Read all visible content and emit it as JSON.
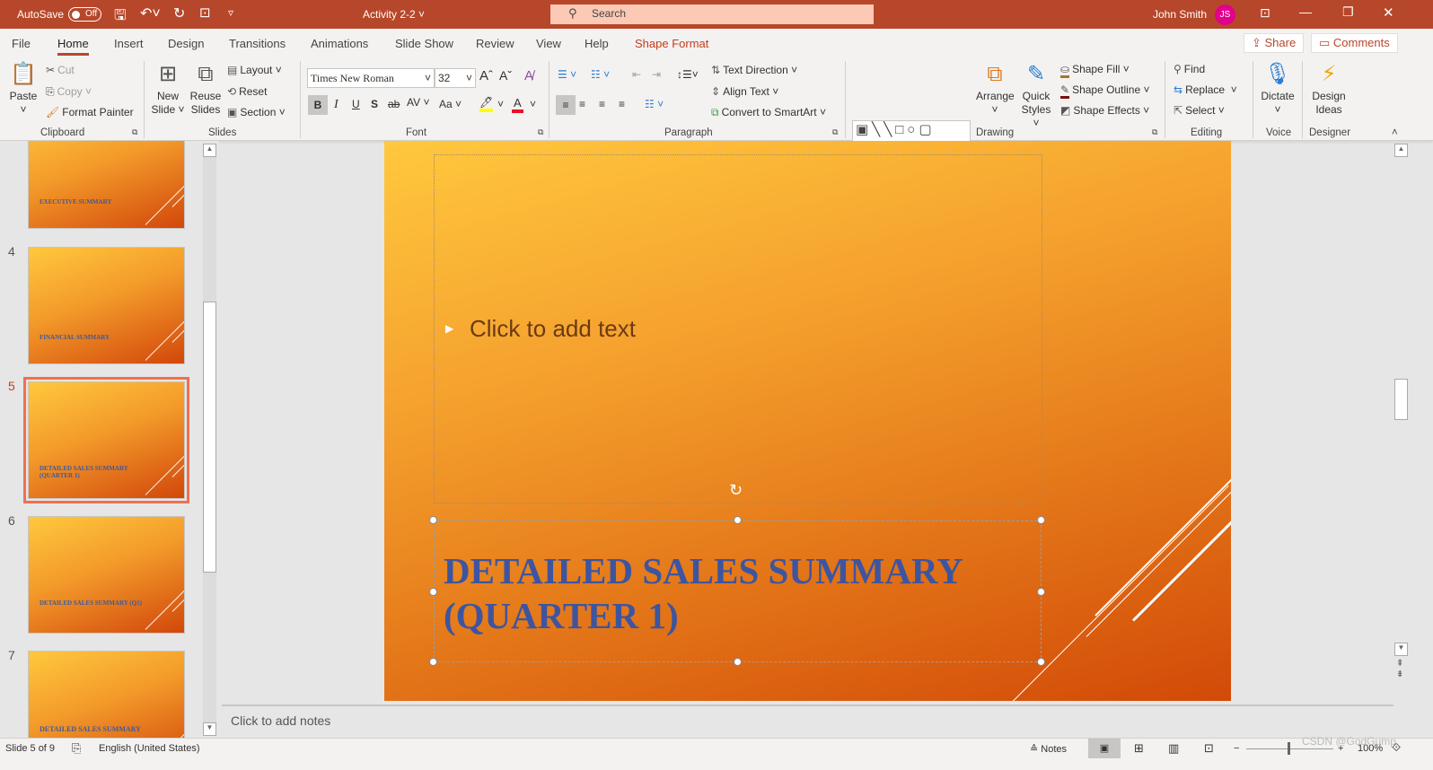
{
  "titlebar": {
    "autosave": "AutoSave",
    "autosave_state": "Off",
    "doc_title": "Activity 2-2",
    "search_placeholder": "Search",
    "user": "John Smith",
    "initials": "JS"
  },
  "tabs": [
    "File",
    "Home",
    "Insert",
    "Design",
    "Transitions",
    "Animations",
    "Slide Show",
    "Review",
    "View",
    "Help",
    "Shape Format"
  ],
  "share": "Share",
  "comments": "Comments",
  "ribbon": {
    "clipboard": {
      "paste": "Paste",
      "cut": "Cut",
      "copy": "Copy",
      "format_painter": "Format Painter",
      "label": "Clipboard"
    },
    "slides": {
      "new_slide": "New Slide",
      "reuse": "Reuse Slides",
      "layout": "Layout",
      "reset": "Reset",
      "section": "Section",
      "label": "Slides"
    },
    "font": {
      "family": "Times New Roman",
      "size": "32",
      "label": "Font"
    },
    "paragraph": {
      "text_direction": "Text Direction",
      "align_text": "Align Text",
      "smartart": "Convert to SmartArt",
      "label": "Paragraph"
    },
    "drawing": {
      "arrange": "Arrange",
      "quick_styles": "Quick Styles",
      "shape_fill": "Shape Fill",
      "shape_outline": "Shape Outline",
      "shape_effects": "Shape Effects",
      "label": "Drawing"
    },
    "editing": {
      "find": "Find",
      "replace": "Replace",
      "select": "Select",
      "label": "Editing"
    },
    "voice": {
      "dictate": "Dictate",
      "label": "Voice"
    },
    "designer": {
      "ideas": "Design Ideas",
      "label": "Designer"
    }
  },
  "thumbnails": [
    {
      "num": "",
      "title": "EXECUTIVE SUMMARY"
    },
    {
      "num": "4",
      "title": "FINANCIAL SUMMARY"
    },
    {
      "num": "5",
      "title": "DETAILED SALES SUMMARY (QUARTER 1)",
      "selected": true
    },
    {
      "num": "6",
      "title": "DETAILED SALES SUMMARY (Q1)"
    },
    {
      "num": "7",
      "title": "DETAILED SALES SUMMARY"
    }
  ],
  "slide": {
    "content_placeholder": "Click to add text",
    "title": "DETAILED SALES SUMMARY (QUARTER 1)"
  },
  "notes_placeholder": "Click to add notes",
  "status": {
    "slide": "Slide 5 of 9",
    "language": "English (United States)",
    "notes": "Notes",
    "zoom": "100%",
    "watermark": "CSDN @GodGump"
  }
}
